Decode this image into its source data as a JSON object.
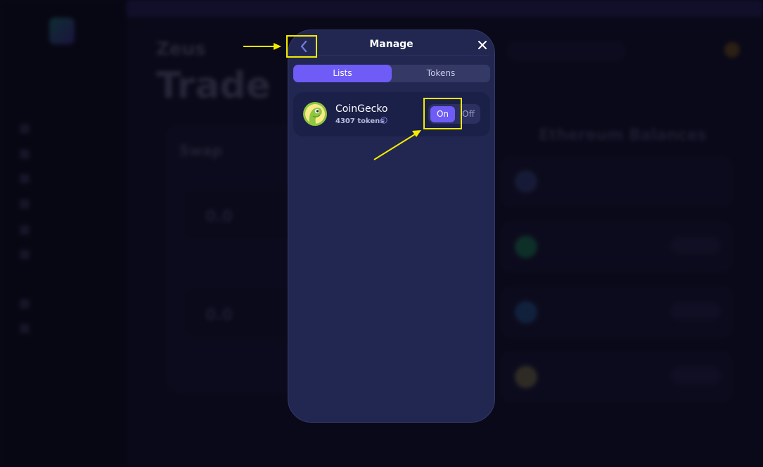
{
  "background": {
    "page_subtitle": "Zeus",
    "page_title": "Trade",
    "swap_label": "Swap",
    "amounts": [
      "0.0",
      "0.0"
    ],
    "balances_title": "Ethereum Balances",
    "nav_items": [
      "",
      "",
      "",
      "",
      "",
      "",
      "",
      ""
    ]
  },
  "modal": {
    "title": "Manage",
    "back_icon": "chevron-left-icon",
    "close_icon": "close-icon",
    "tabs": [
      {
        "label": "Lists",
        "active": true
      },
      {
        "label": "Tokens",
        "active": false
      }
    ],
    "lists": [
      {
        "name": "CoinGecko",
        "token_count": "4307 tokens",
        "logo_icon": "coingecko-logo-icon",
        "toggle_on_label": "On",
        "toggle_off_label": "Off",
        "enabled": true
      }
    ]
  },
  "colors": {
    "accent": "#6f5cf6",
    "modal_bg": "#222751",
    "card_bg": "#1b2048",
    "highlight": "#f5ea00"
  }
}
